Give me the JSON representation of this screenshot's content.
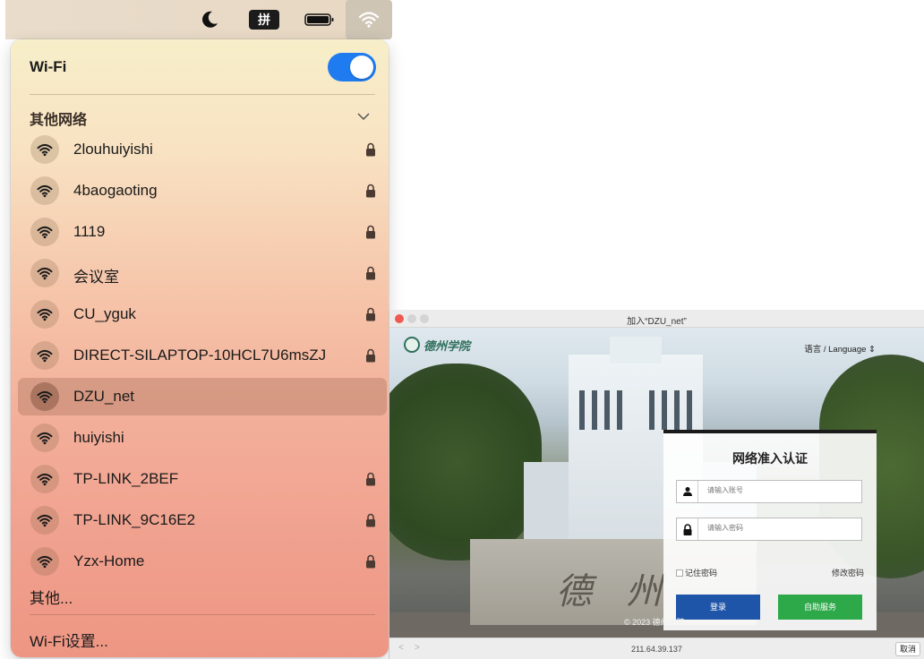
{
  "menubar": {
    "icons": [
      "moon-icon",
      "input-method-icon",
      "battery-icon",
      "wifi-icon"
    ],
    "input_method_label": "拼"
  },
  "wifi_panel": {
    "title": "Wi-Fi",
    "toggle_on": true,
    "section_label": "其他网络",
    "networks": [
      {
        "name": "2louhuiyishi",
        "locked": true,
        "selected": false
      },
      {
        "name": "4baogaoting",
        "locked": true,
        "selected": false
      },
      {
        "name": "1119",
        "locked": true,
        "selected": false
      },
      {
        "name": "会议室",
        "locked": true,
        "selected": false
      },
      {
        "name": "CU_yguk",
        "locked": true,
        "selected": false
      },
      {
        "name": "DIRECT-SILAPTOP-10HCL7U6msZJ",
        "locked": true,
        "selected": false
      },
      {
        "name": "DZU_net",
        "locked": false,
        "selected": true
      },
      {
        "name": "huiyishi",
        "locked": false,
        "selected": false
      },
      {
        "name": "TP-LINK_2BEF",
        "locked": true,
        "selected": false
      },
      {
        "name": "TP-LINK_9C16E2",
        "locked": true,
        "selected": false
      },
      {
        "name": "Yzx-Home",
        "locked": true,
        "selected": false
      }
    ],
    "other_label": "其他...",
    "settings_label": "Wi-Fi设置..."
  },
  "portal": {
    "window_title": "加入“DZU_net”",
    "language_label": "语言 / Language  ⇕",
    "stone_chars": [
      "德",
      "州"
    ],
    "login": {
      "heading": "网络准入认证",
      "username_placeholder": "请输入账号",
      "password_placeholder": "请输入密码",
      "remember_label": "记住密码",
      "change_password_label": "修改密码",
      "login_button": "登录",
      "self_service_button": "自助服务"
    },
    "copyright": "© 2023  德州学院",
    "nav_back": "<",
    "nav_forward": ">",
    "url": "211.64.39.137",
    "cancel_button": "取消",
    "colors": {
      "login_button": "#1f55a8",
      "self_service_button": "#2ea94a"
    }
  }
}
